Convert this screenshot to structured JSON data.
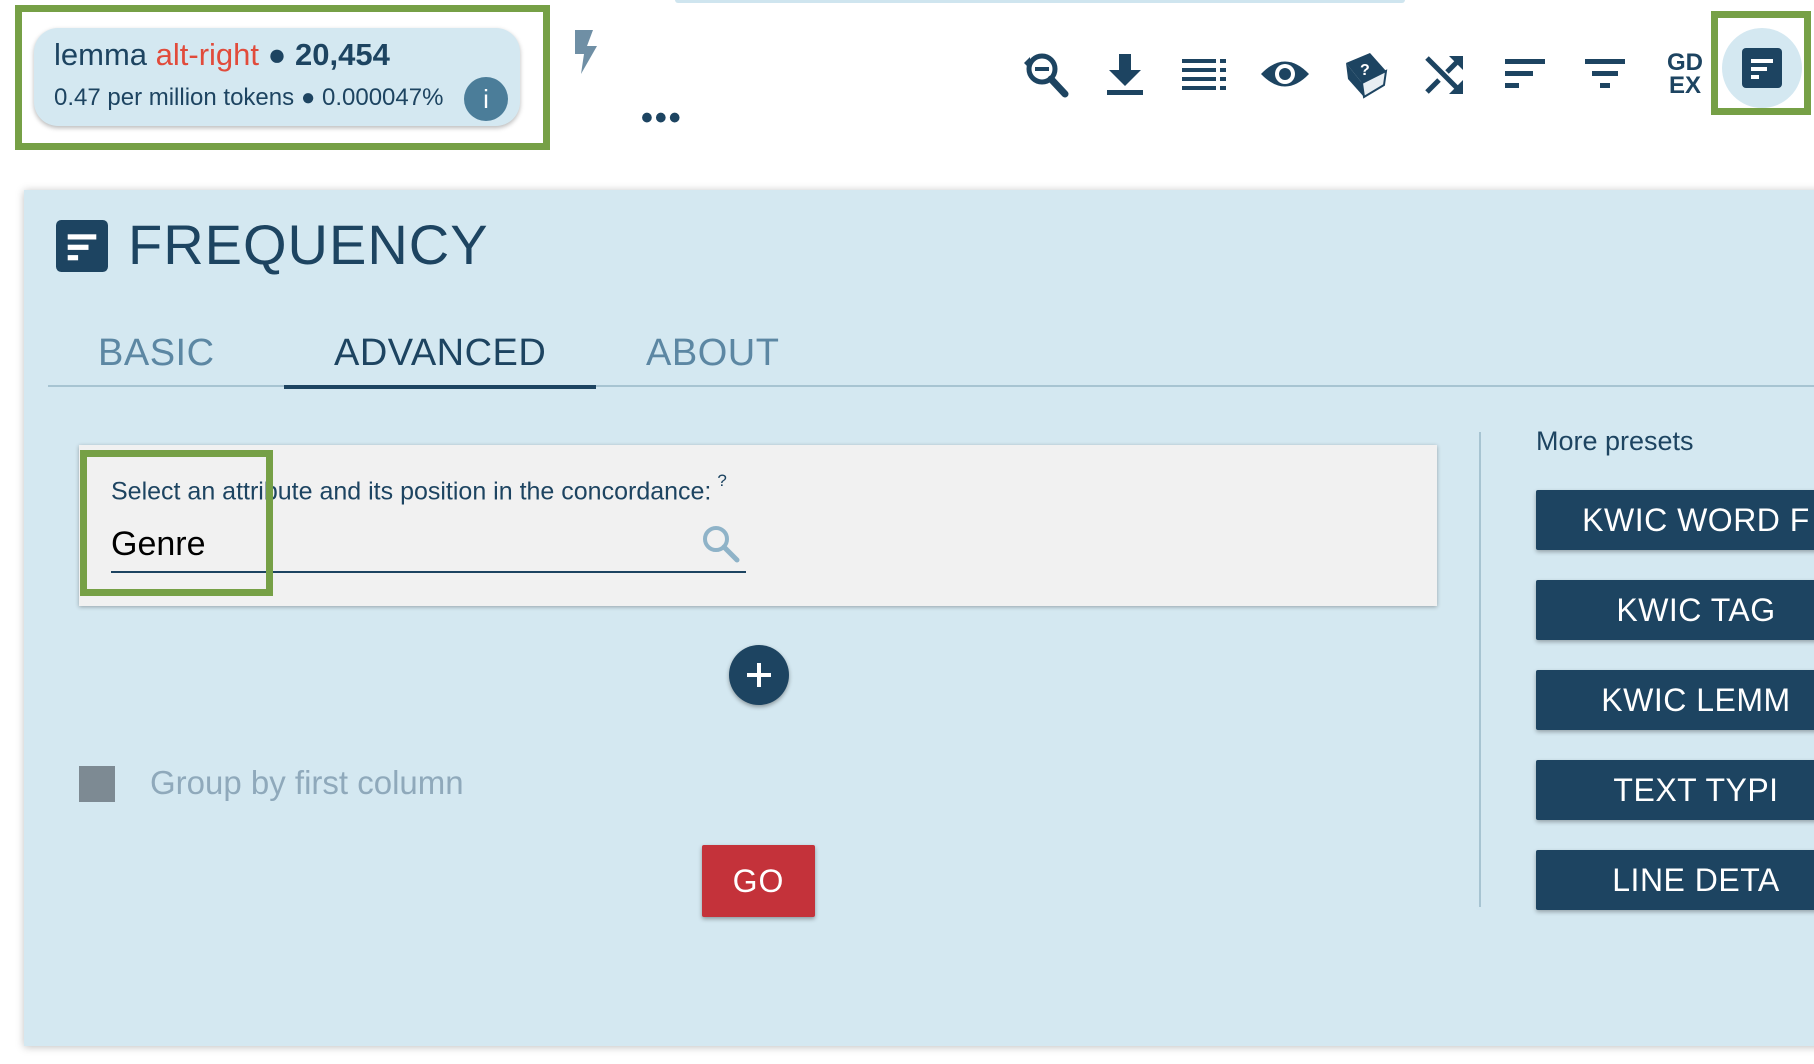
{
  "result": {
    "attribute": "lemma",
    "value": "alt-right",
    "separator": "●",
    "count": "20,454",
    "per_million": "0.47 per million tokens",
    "percent": "0.000047%",
    "info_glyph": "i"
  },
  "toolbar": {
    "more_label": "•••",
    "gdex_label_top": "GD",
    "gdex_label_bottom": "EX",
    "icons": [
      "bolt-icon",
      "search-minus-icon",
      "download-icon",
      "view-list-icon",
      "eye-icon",
      "random-dice-icon",
      "shuffle-icon",
      "sort-icon",
      "filter-icon",
      "gdex-icon",
      "frequency-icon"
    ]
  },
  "panel": {
    "title": "FREQUENCY",
    "tabs": [
      {
        "label": "BASIC",
        "active": false
      },
      {
        "label": "ADVANCED",
        "active": true
      },
      {
        "label": "ABOUT",
        "active": false
      }
    ],
    "attribute_label": "Select an attribute and its position in the concordance:",
    "attribute_help": "?",
    "attribute_value": "Genre",
    "group_by_label": "Group by first column",
    "go_label": "GO",
    "presets_title": "More presets",
    "presets": [
      "KWIC WORD F",
      "KWIC TAG",
      "KWIC LEMM",
      "TEXT TYPI",
      "LINE DETA"
    ]
  },
  "colors": {
    "accent": "#1d4461",
    "panel_bg": "#d4e8f1",
    "go": "#c4323a",
    "highlight": "#76a046",
    "lemma_value": "#e14b3b"
  }
}
